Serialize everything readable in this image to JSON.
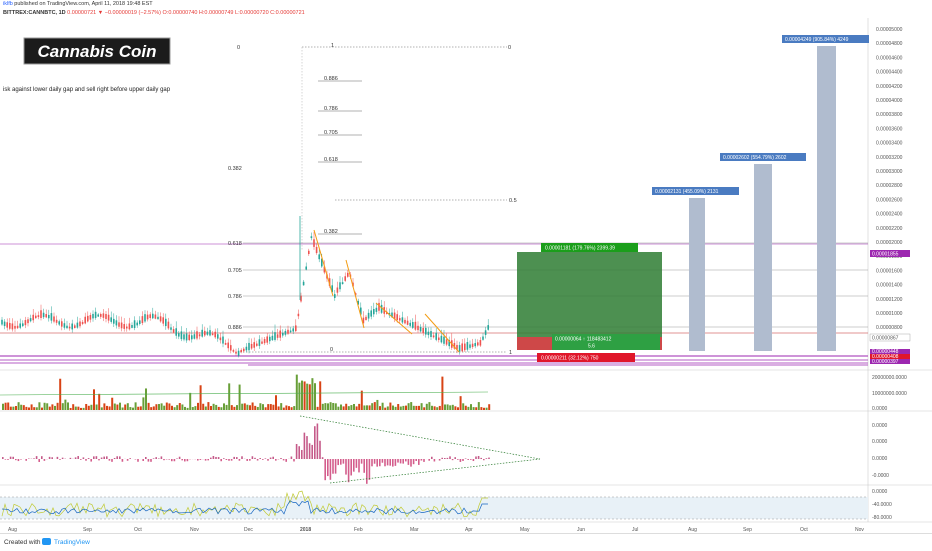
{
  "header": {
    "line1_user": "iklfb",
    "line1_rest": " published on TradingView.com, April 11, 2018 19:48 EST",
    "line2_symbol": "BITTREX:CANNBTC, 1D",
    "line2_change": " 0.00000721 ▼ −0.00000019 (−2.57%)",
    "line2_ohlc": " O:0.00000740 H:0.00000749 L:0.00000720 C:0.00000721"
  },
  "title_badge": "Cannabis Coin",
  "annotation": "isk against lower daily gap and sell right before upper daily gap",
  "price_axis": [
    "0.00005000",
    "0.00004800",
    "0.00004600",
    "0.00004400",
    "0.00004200",
    "0.00004000",
    "0.00003800",
    "0.00003600",
    "0.00003400",
    "0.00003200",
    "0.00003000",
    "0.00002800",
    "0.00002600",
    "0.00002400",
    "0.00002200",
    "0.00002000",
    "0.00001800",
    "0.00001600",
    "0.00001400",
    "0.00001200",
    "0.00001000",
    "0.00000800"
  ],
  "price_tags": {
    "upper_gap": "0.00001855",
    "current": "0.00000867",
    "tag1": "0.00000448",
    "tag2": "0.00000408",
    "tag3": "0.00000397"
  },
  "volume_axis": [
    "20000000.0000",
    "10000000.0000",
    "0.0000"
  ],
  "macd_axis": [
    "0.0000",
    "0.0000",
    "0.0000",
    "-0.0000"
  ],
  "rsi_axis": [
    "0.0000",
    "-40.0000",
    "-80.0000"
  ],
  "time_axis": [
    "Aug",
    "Sep",
    "Oct",
    "Nov",
    "Dec",
    "2018",
    "Feb",
    "Mar",
    "Apr",
    "May",
    "Jun",
    "Jul",
    "Aug",
    "Sep",
    "Oct",
    "Nov"
  ],
  "fib_left": [
    "0",
    "0.382",
    "0.618",
    "0.705",
    "0.786",
    "0.886",
    "0"
  ],
  "fib_upper": [
    "1",
    "0.886",
    "0.786",
    "0.705",
    "0.618",
    "0.382"
  ],
  "fib_mid": {
    "one": "1",
    "zero": "0",
    "half": "0.5"
  },
  "boxes": {
    "green": "0.00001181 (179.76%) 2399.39",
    "entry_line1": "0.00000064 ↑ 118483412",
    "entry_line2": "5.6",
    "red": "0.00000211 (32.12%) 750",
    "target1": "0.00002131 (455.09%) 2131",
    "target2": "0.00002602 (554.79%) 2602",
    "target3": "0.00004249 (905.84%) 4249"
  },
  "footer": {
    "created_with": "Created with",
    "brand": "TradingView"
  },
  "colors": {
    "green_zone": "#1b5e20",
    "red_zone": "#c62828",
    "target_bar": "#b0bccf",
    "purple": "#9c27b0",
    "accent_blue": "#4a7bc1"
  }
}
